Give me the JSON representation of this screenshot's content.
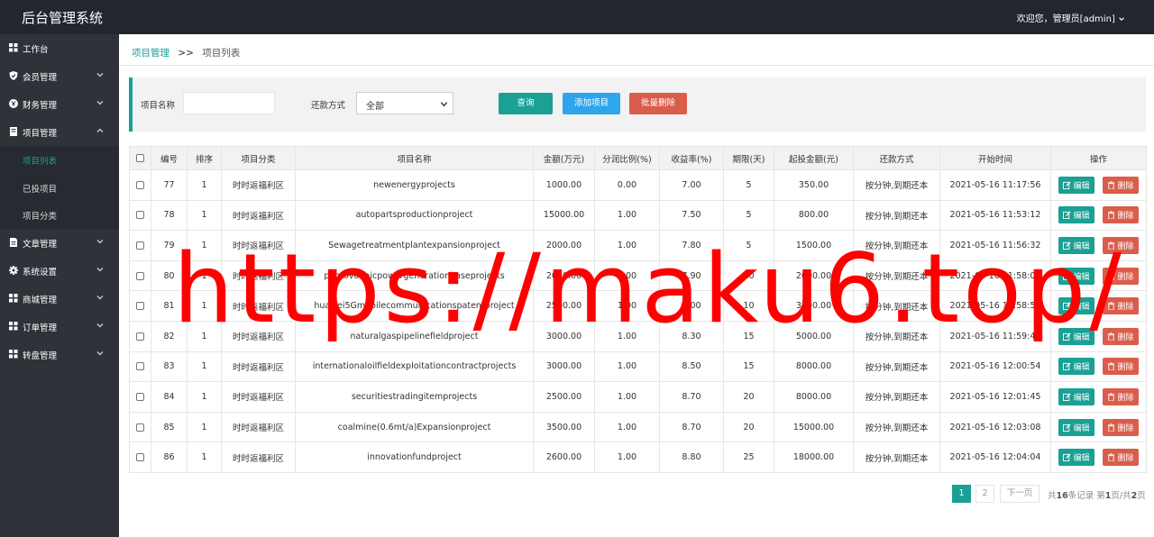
{
  "app": {
    "title": "后台管理系统",
    "user_menu": "欢迎您，管理员[admin]"
  },
  "sidebar": {
    "items": [
      {
        "label": "工作台",
        "icon": "dashboard-icon",
        "has_chevron": false
      },
      {
        "label": "会员管理",
        "icon": "shield-icon",
        "has_chevron": true,
        "expanded": false
      },
      {
        "label": "财务管理",
        "icon": "yen-icon",
        "has_chevron": true,
        "expanded": false
      },
      {
        "label": "项目管理",
        "icon": "book-icon",
        "has_chevron": true,
        "expanded": true,
        "children": [
          {
            "label": "项目列表",
            "active": true
          },
          {
            "label": "已投项目",
            "active": false
          },
          {
            "label": "项目分类",
            "active": false
          }
        ]
      },
      {
        "label": "文章管理",
        "icon": "document-icon",
        "has_chevron": true,
        "expanded": false
      },
      {
        "label": "系统设置",
        "icon": "gear-icon",
        "has_chevron": true,
        "expanded": false
      },
      {
        "label": "商城管理",
        "icon": "shop-icon",
        "has_chevron": true,
        "expanded": false
      },
      {
        "label": "订单管理",
        "icon": "order-icon",
        "has_chevron": true,
        "expanded": false
      },
      {
        "label": "转盘管理",
        "icon": "wheel-icon",
        "has_chevron": true,
        "expanded": false
      }
    ]
  },
  "breadcrumb": {
    "parent": "项目管理",
    "separator": ">>",
    "current": "项目列表"
  },
  "filter": {
    "name_label": "项目名称",
    "name_value": "",
    "repay_label": "还款方式",
    "repay_selected": "全部",
    "search_button": "查询",
    "add_button": "添加项目",
    "batch_delete_button": "批量删除"
  },
  "table": {
    "headers": [
      "编号",
      "排序",
      "项目分类",
      "项目名称",
      "金额(万元)",
      "分润比例(%)",
      "收益率(%)",
      "期限(天)",
      "起投金额(元)",
      "还款方式",
      "开始时间",
      "操作"
    ],
    "edit_label": "编辑",
    "delete_label": "删除",
    "rows": [
      [
        "77",
        "1",
        "时时返福利区",
        "newenergyprojects",
        "1000.00",
        "0.00",
        "7.00",
        "5",
        "350.00",
        "按分钟,到期还本",
        "2021-05-16 11:17:56"
      ],
      [
        "78",
        "1",
        "时时返福利区",
        "autopartsproductionproject",
        "15000.00",
        "1.00",
        "7.50",
        "5",
        "800.00",
        "按分钟,到期还本",
        "2021-05-16 11:53:12"
      ],
      [
        "79",
        "1",
        "时时返福利区",
        "Sewagetreatmentplantexpansionproject",
        "2000.00",
        "1.00",
        "7.80",
        "5",
        "1500.00",
        "按分钟,到期还本",
        "2021-05-16 11:56:32"
      ],
      [
        "80",
        "1",
        "时时返福利区",
        "photovoltaicpowergenerationbaseprojects",
        "2000.00",
        "1.00",
        "7.90",
        "10",
        "2000.00",
        "按分钟,到期还本",
        "2021-05-16 11:58:01"
      ],
      [
        "81",
        "1",
        "时时返福利区",
        "huawei5Gmobilecommunicationspatentproject",
        "2500.00",
        "1.00",
        "8.00",
        "10",
        "3500.00",
        "按分钟,到期还本",
        "2021-05-16 11:58:53"
      ],
      [
        "82",
        "1",
        "时时返福利区",
        "naturalgaspipelinefieldproject",
        "3000.00",
        "1.00",
        "8.30",
        "15",
        "5000.00",
        "按分钟,到期还本",
        "2021-05-16 11:59:46"
      ],
      [
        "83",
        "1",
        "时时返福利区",
        "internationaloilfieldexploitationcontractprojects",
        "3000.00",
        "1.00",
        "8.50",
        "15",
        "8000.00",
        "按分钟,到期还本",
        "2021-05-16 12:00:54"
      ],
      [
        "84",
        "1",
        "时时返福利区",
        "securitiestradingitemprojects",
        "2500.00",
        "1.00",
        "8.70",
        "20",
        "8000.00",
        "按分钟,到期还本",
        "2021-05-16 12:01:45"
      ],
      [
        "85",
        "1",
        "时时返福利区",
        "coalmine(0.6mt/a)Expansionproject",
        "3500.00",
        "1.00",
        "8.70",
        "20",
        "15000.00",
        "按分钟,到期还本",
        "2021-05-16 12:03:08"
      ],
      [
        "86",
        "1",
        "时时返福利区",
        "innovationfundproject",
        "2600.00",
        "1.00",
        "8.80",
        "25",
        "18000.00",
        "按分钟,到期还本",
        "2021-05-16 12:04:04"
      ]
    ]
  },
  "pagination": {
    "pages": [
      "1",
      "2"
    ],
    "current": "1",
    "next_label": "下一页",
    "info_prefix": "共",
    "total": "16",
    "info_mid": "条记录 第",
    "page_current": "1",
    "info_mid2": "页/共",
    "page_total": "2",
    "info_suffix": "页"
  },
  "watermark": "https://maku6.top/",
  "colors": {
    "accent": "#1aa094",
    "header_bg": "#23262e",
    "sidebar_bg": "#2f3238",
    "add_button": "#2ea6ec",
    "delete_button": "#da5d4b",
    "watermark": "#ff0000"
  }
}
